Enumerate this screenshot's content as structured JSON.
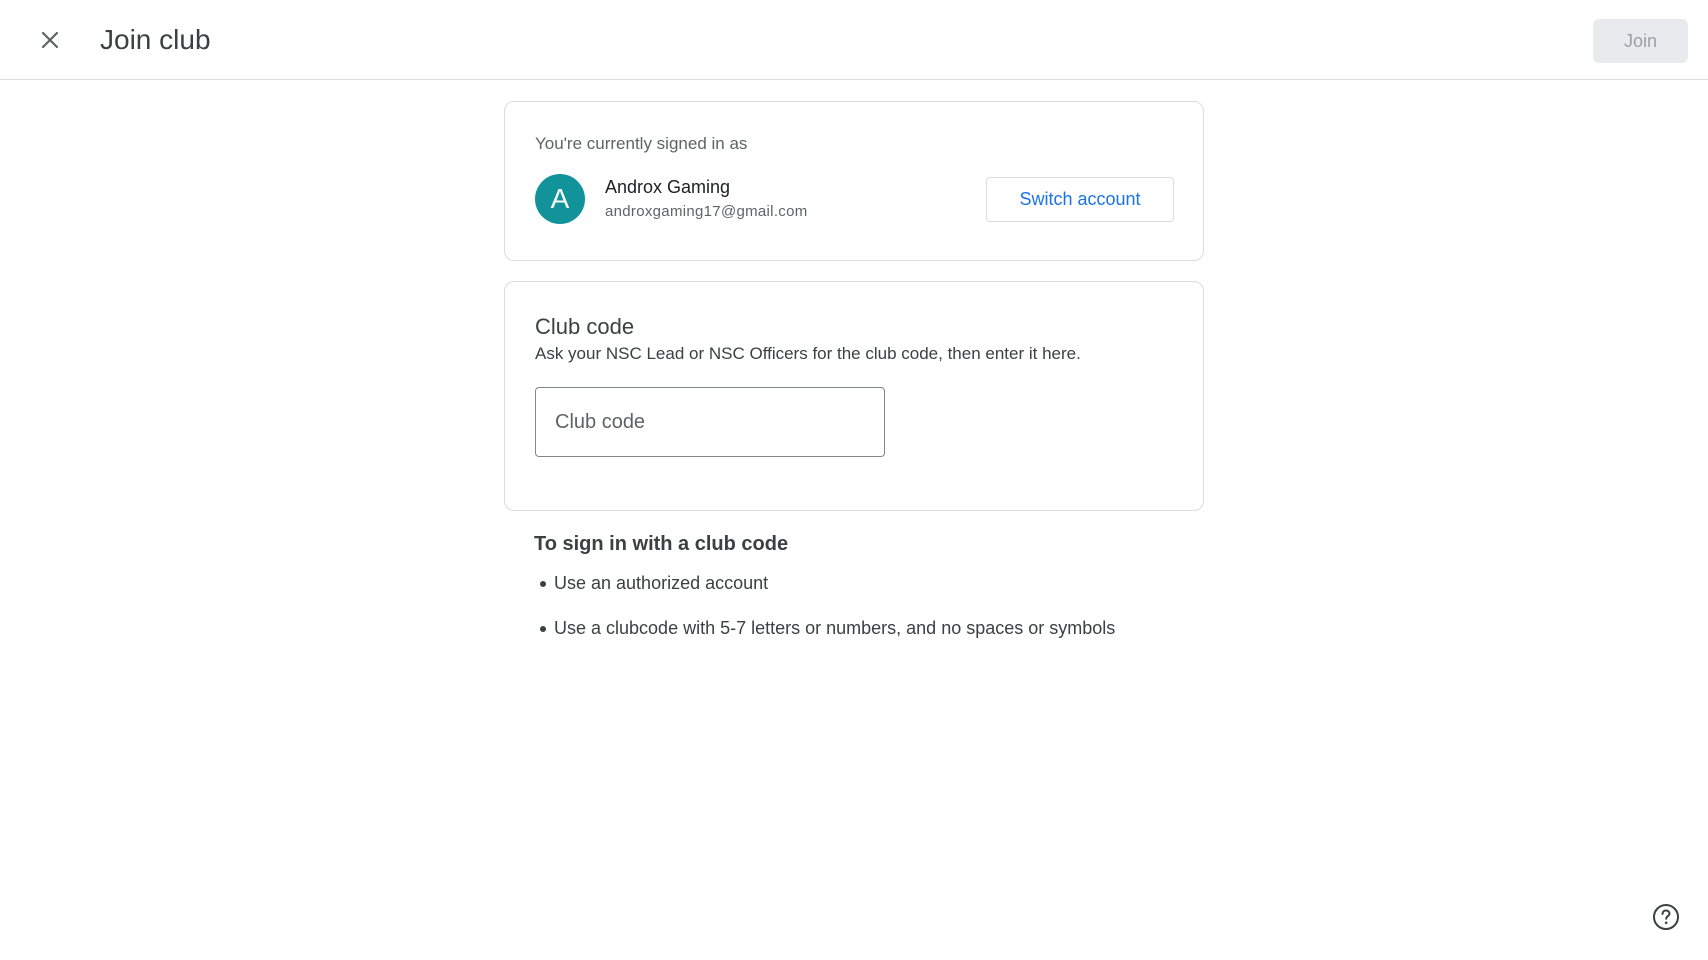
{
  "header": {
    "close_icon": "close-icon",
    "title": "Join club",
    "join_label": "Join"
  },
  "account": {
    "signed_in_label": "You're currently signed in as",
    "avatar_letter": "A",
    "avatar_color": "#12939a",
    "name": "Androx Gaming",
    "email": "androxgaming17@gmail.com",
    "switch_label": "Switch account"
  },
  "club_code": {
    "title": "Club code",
    "description": "Ask your NSC Lead or NSC Officers for the club code, then enter it here.",
    "input_value": "",
    "input_placeholder": "Club code"
  },
  "help": {
    "title": "To sign in with a club code",
    "items": [
      "Use an authorized account",
      "Use a clubcode with 5-7 letters or numbers, and no spaces or symbols"
    ],
    "help_icon": "help-icon"
  },
  "colors": {
    "accent": "#1a73e8",
    "disabled_button_bg": "#e8eaed"
  }
}
